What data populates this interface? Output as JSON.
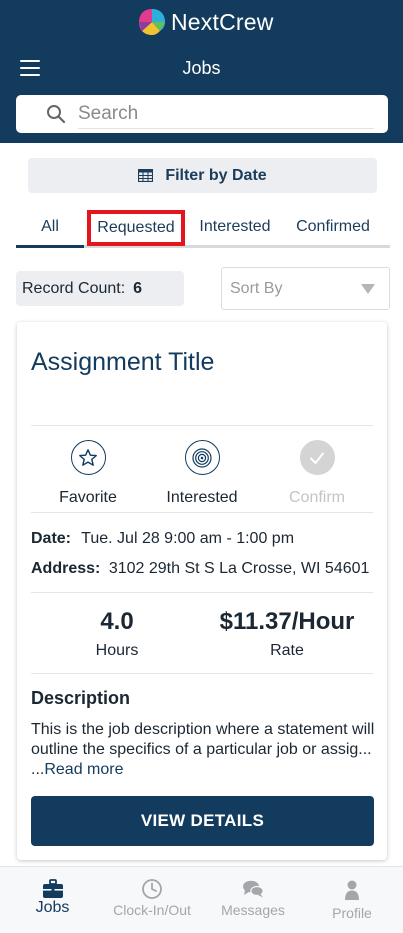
{
  "app": {
    "name": "NextCrew",
    "page_title": "Jobs"
  },
  "search": {
    "placeholder": "Search"
  },
  "filter": {
    "label": "Filter by Date"
  },
  "tabs": [
    {
      "label": "All",
      "active": true
    },
    {
      "label": "Requested",
      "highlighted": true
    },
    {
      "label": "Interested"
    },
    {
      "label": "Confirmed"
    }
  ],
  "record_count": {
    "label": "Record Count:",
    "value": "6"
  },
  "sort": {
    "placeholder": "Sort By"
  },
  "card": {
    "title": "Assignment Title",
    "actions": [
      {
        "label": "Favorite",
        "icon": "star-icon",
        "enabled": true
      },
      {
        "label": "Interested",
        "icon": "target-icon",
        "enabled": true
      },
      {
        "label": "Confirm",
        "icon": "check-icon",
        "enabled": false
      }
    ],
    "date_label": "Date:",
    "date_value": "Tue. Jul 28 9:00 am - 1:00 pm",
    "address_label": "Address:",
    "address_value": "3102 29th St S La Crosse, WI 54601",
    "hours_value": "4.0",
    "hours_label": "Hours",
    "rate_value": "$11.37/Hour",
    "rate_label": "Rate",
    "description_heading": "Description",
    "description_text": "This is the job description where a statement will outline the specifics of a particular job or assig... ...",
    "read_more": "Read more",
    "view_details": "VIEW DETAILS"
  },
  "bottom_nav": [
    {
      "label": "Jobs",
      "icon": "briefcase-icon",
      "active": true
    },
    {
      "label": "Clock-In/Out",
      "icon": "clock-icon"
    },
    {
      "label": "Messages",
      "icon": "chat-icon"
    },
    {
      "label": "Profile",
      "icon": "person-icon"
    }
  ],
  "colors": {
    "primary": "#123b5e",
    "highlight": "#e4161d",
    "muted": "#a3a7ab"
  }
}
